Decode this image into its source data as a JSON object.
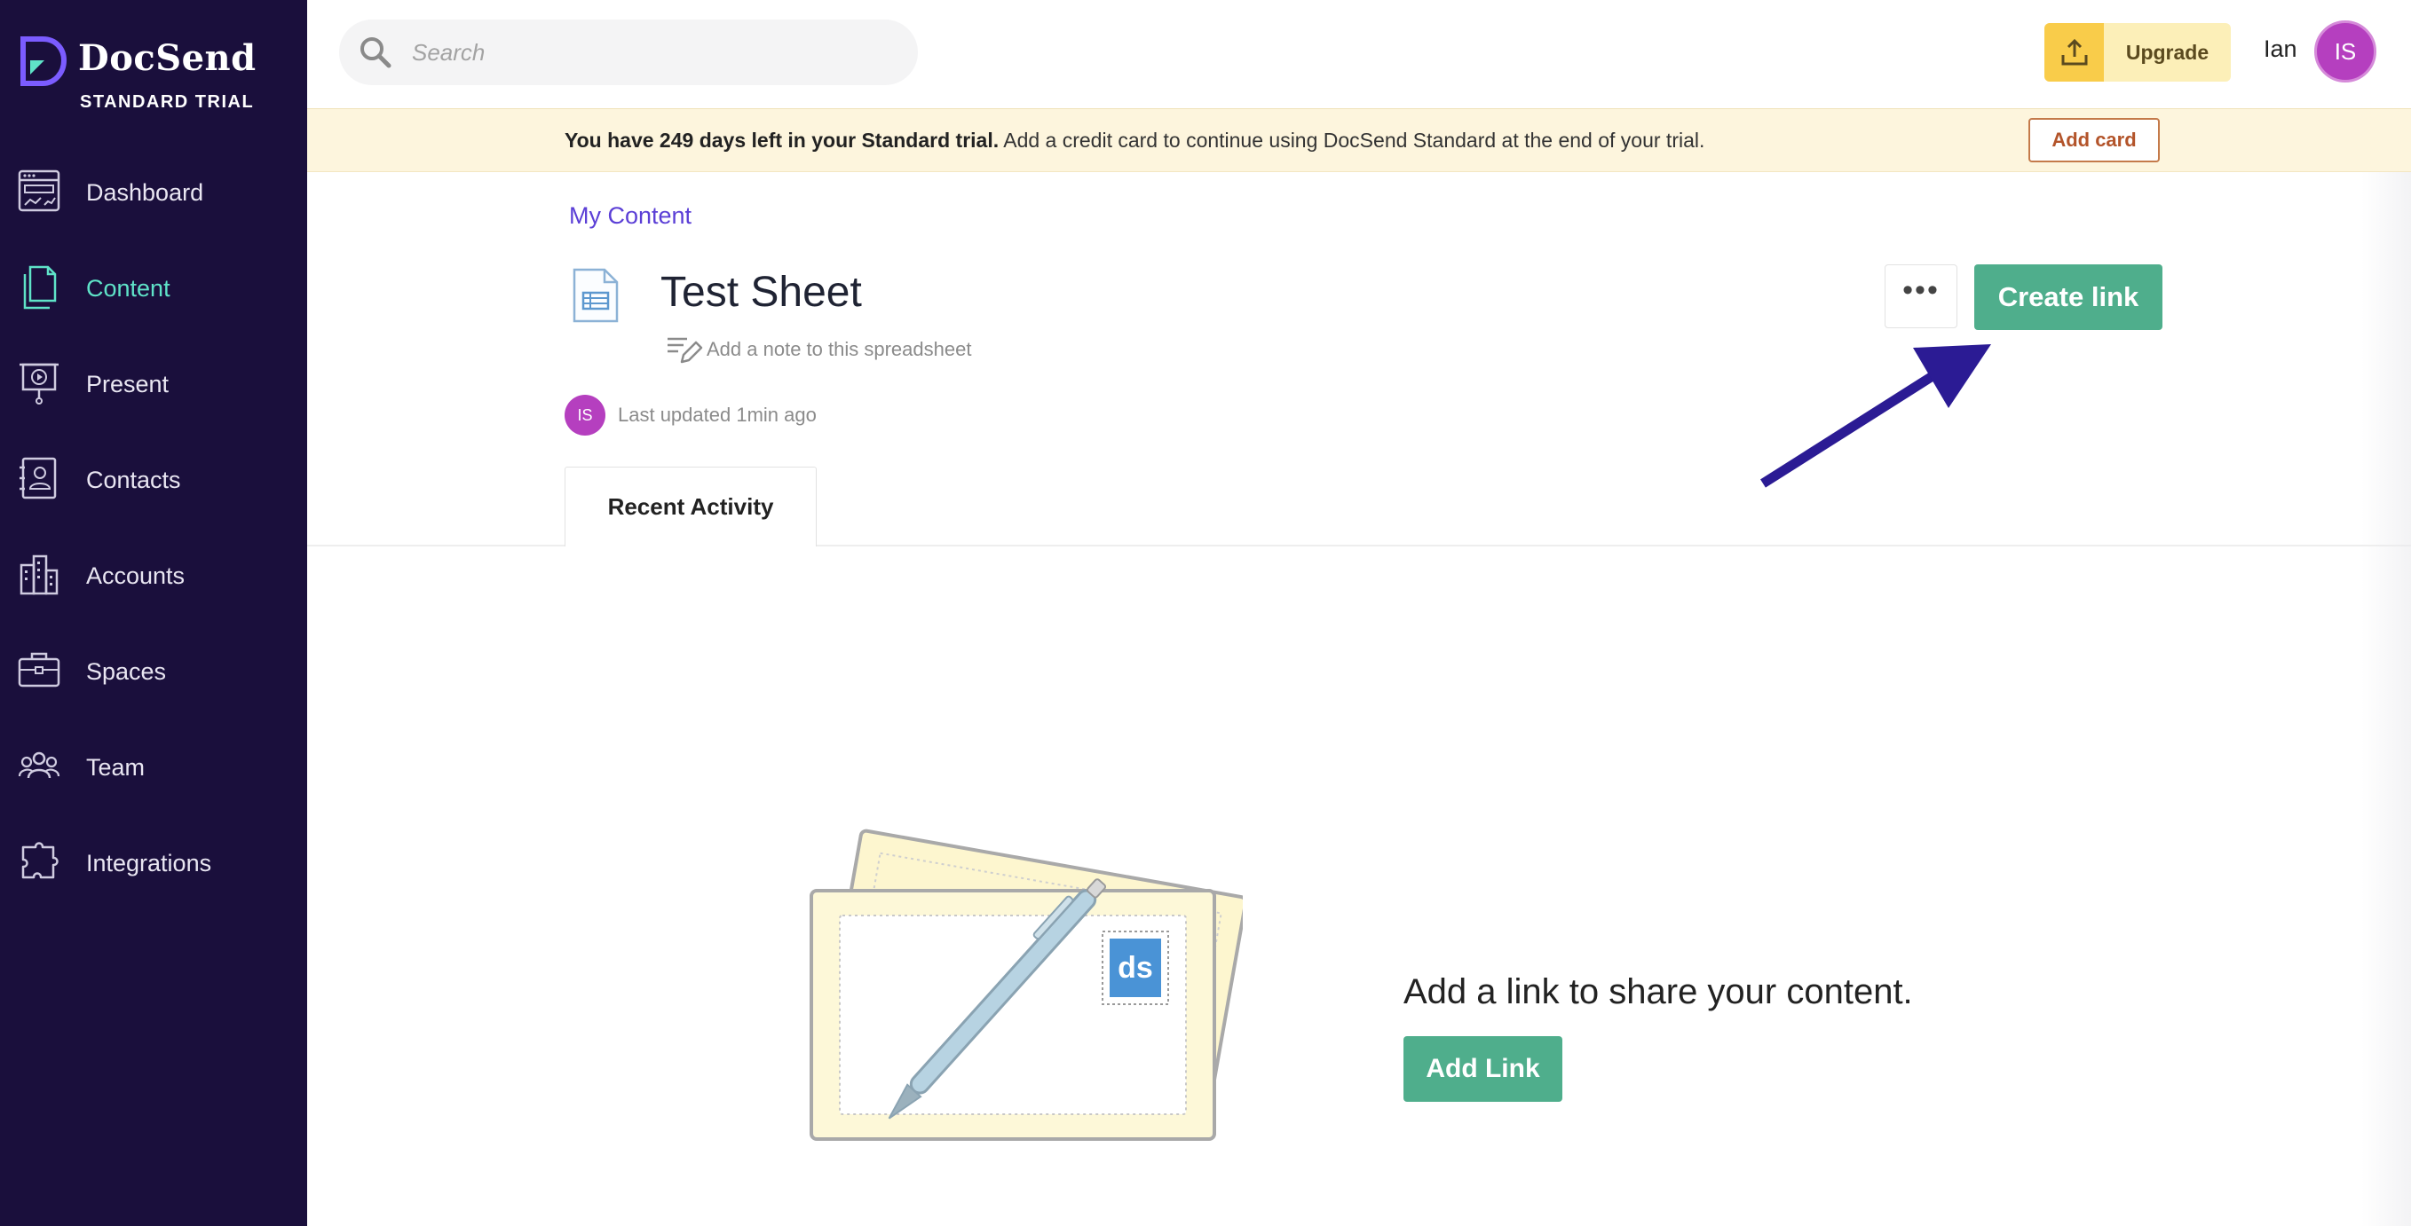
{
  "brand": {
    "name": "DocSend",
    "plan": "STANDARD TRIAL"
  },
  "sidebar": {
    "items": [
      {
        "label": "Dashboard",
        "icon": "dashboard-icon"
      },
      {
        "label": "Content",
        "icon": "content-icon",
        "active": true
      },
      {
        "label": "Present",
        "icon": "present-icon"
      },
      {
        "label": "Contacts",
        "icon": "contacts-icon"
      },
      {
        "label": "Accounts",
        "icon": "accounts-icon"
      },
      {
        "label": "Spaces",
        "icon": "spaces-icon"
      },
      {
        "label": "Team",
        "icon": "team-icon"
      },
      {
        "label": "Integrations",
        "icon": "integrations-icon"
      }
    ]
  },
  "topbar": {
    "search_placeholder": "Search",
    "upgrade_label": "Upgrade",
    "user_name": "Ian",
    "user_initials": "IS"
  },
  "banner": {
    "bold_text": "You have 249 days left in your Standard trial.",
    "text": " Add a credit card to continue using DocSend Standard at the end of your trial.",
    "button_label": "Add card"
  },
  "content": {
    "breadcrumb": "My Content",
    "title": "Test Sheet",
    "note_placeholder": "Add a note to this spreadsheet",
    "updated_initials": "IS",
    "updated_text": "Last updated 1min ago",
    "more_label": "•••",
    "create_link_label": "Create link",
    "tab_label": "Recent Activity"
  },
  "empty_state": {
    "message": "Add a link to share your content.",
    "button_label": "Add Link",
    "stamp_text": "ds"
  },
  "colors": {
    "sidebar_bg": "#1a0f3c",
    "active_nav": "#5fe3c8",
    "accent_purple": "#5b3fd6",
    "primary_green": "#4fae8c",
    "banner_bg": "#fdf5dd",
    "upgrade_yellow": "#f9cc4a",
    "avatar_purple": "#b53fbf",
    "arrow": "#2b1b94"
  }
}
